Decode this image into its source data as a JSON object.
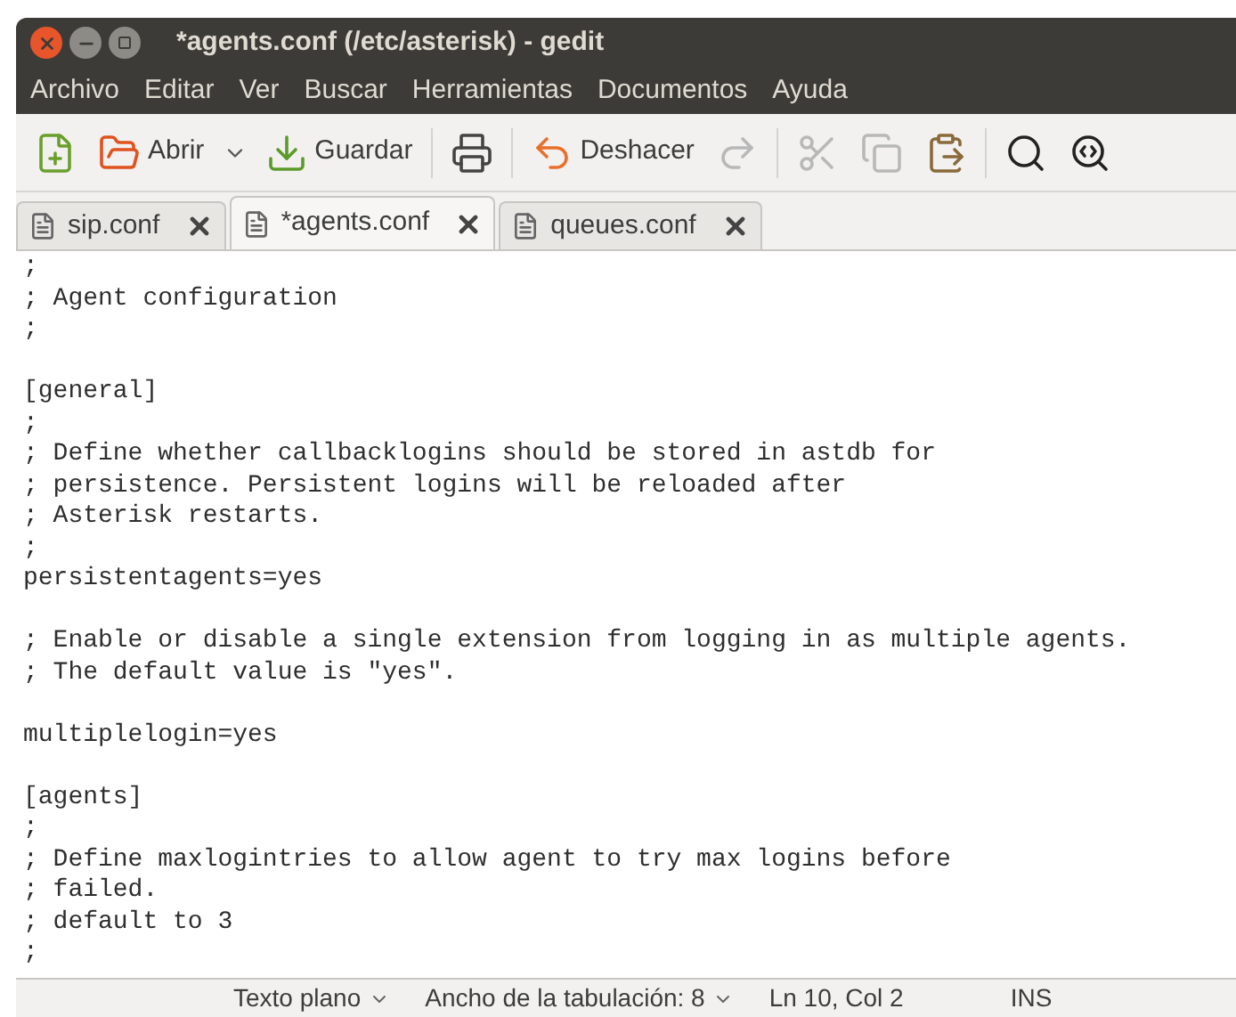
{
  "window": {
    "title": "*agents.conf (/etc/asterisk) - gedit"
  },
  "menu": [
    "Archivo",
    "Editar",
    "Ver",
    "Buscar",
    "Herramientas",
    "Documentos",
    "Ayuda"
  ],
  "toolbar": [
    {
      "kind": "button",
      "disabled": false
    },
    {
      "kind": "button",
      "label": "Abrir",
      "disabled": false
    },
    {
      "kind": "dropdown",
      "disabled": false
    },
    {
      "kind": "button",
      "label": "Guardar",
      "disabled": false
    },
    {
      "kind": "separator"
    },
    {
      "kind": "button",
      "disabled": false
    },
    {
      "kind": "separator"
    },
    {
      "kind": "button",
      "label": "Deshacer",
      "disabled": false
    },
    {
      "kind": "button",
      "disabled": true
    },
    {
      "kind": "separator"
    },
    {
      "kind": "button",
      "disabled": true
    },
    {
      "kind": "button",
      "disabled": true
    },
    {
      "kind": "button",
      "disabled": false
    },
    {
      "kind": "separator"
    },
    {
      "kind": "button",
      "disabled": false
    },
    {
      "kind": "button",
      "disabled": false
    }
  ],
  "tabs": [
    {
      "label": "sip.conf",
      "selected": false
    },
    {
      "label": "*agents.conf",
      "selected": true
    },
    {
      "label": "queues.conf",
      "selected": false
    }
  ],
  "editor": {
    "blocks": [
      [
        ";",
        "; Agent configuration",
        ";"
      ],
      [
        "[general]",
        ";",
        "; Define whether callbacklogins should be stored in astdb for",
        "; persistence. Persistent logins will be reloaded after",
        "; Asterisk restarts.",
        ";",
        "persistentagents=yes"
      ],
      [
        "; Enable or disable a single extension from logging in as multiple agents.",
        "; The default value is \"yes\"."
      ],
      [
        "multiplelogin=yes"
      ],
      [
        "[agents]",
        ";",
        "; Define maxlogintries to allow agent to try max logins before",
        "; failed.",
        "; default to 3",
        ";"
      ]
    ]
  },
  "status_bar": [
    {
      "label": "Texto plano",
      "dropdown": true
    },
    {
      "label": "Ancho de la tabulación: 8",
      "dropdown": true
    },
    {
      "label": "Ln 10, Col 2",
      "dropdown": false
    },
    {
      "label": "INS",
      "dropdown": false
    }
  ]
}
